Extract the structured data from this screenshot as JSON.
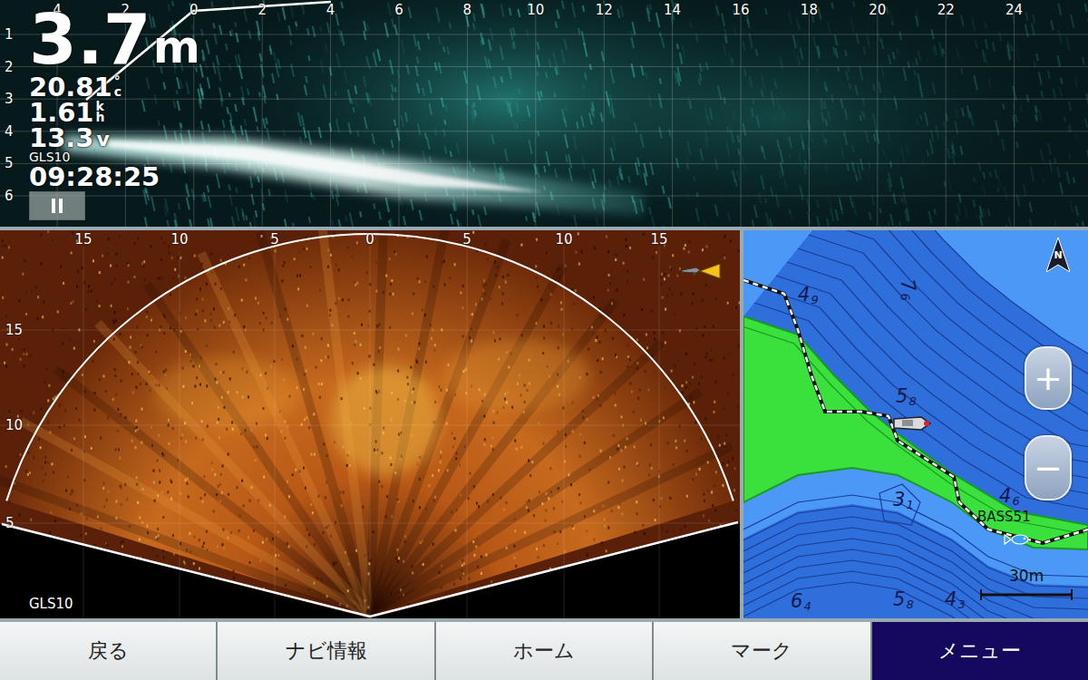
{
  "sonar_top": {
    "x_ticks": [
      "4",
      "2",
      "0",
      "2",
      "4",
      "6",
      "8",
      "10",
      "12",
      "14",
      "16",
      "18",
      "20",
      "22",
      "24"
    ],
    "y_ticks": [
      "1",
      "2",
      "3",
      "4",
      "5",
      "6"
    ],
    "depth": "3.7",
    "depth_unit": "m",
    "temperature": "20.81",
    "temperature_unit_top": "°",
    "temperature_unit_bottom": "c",
    "speed": "1.61",
    "speed_unit_top": "k",
    "speed_unit_bottom": "h",
    "voltage": "13.3",
    "voltage_unit": "v",
    "source": "GLS10",
    "time": "09:28:25"
  },
  "sonar_fan": {
    "x_ticks": [
      "15",
      "10",
      "5",
      "0",
      "5",
      "10",
      "15"
    ],
    "y_ticks": [
      "15",
      "10",
      "5"
    ],
    "source": "GLS10"
  },
  "map": {
    "depth_labels": [
      {
        "value": "4",
        "sub": "9"
      },
      {
        "value": "7",
        "sub": "6"
      },
      {
        "value": "5",
        "sub": "8"
      },
      {
        "value": "3",
        "sub": "1"
      },
      {
        "value": "4",
        "sub": "6"
      },
      {
        "value": "6",
        "sub": "4"
      },
      {
        "value": "5",
        "sub": "8"
      },
      {
        "value": "4",
        "sub": "3"
      }
    ],
    "north": "N",
    "zoom_in": "+",
    "zoom_out": "−",
    "waypoint": "BASS51",
    "scale": "30m"
  },
  "buttons": [
    {
      "label": "戻る",
      "selected": false
    },
    {
      "label": "ナビ情報",
      "selected": false
    },
    {
      "label": "ホーム",
      "selected": false
    },
    {
      "label": "マーク",
      "selected": false
    },
    {
      "label": "メニュー",
      "selected": true
    }
  ]
}
